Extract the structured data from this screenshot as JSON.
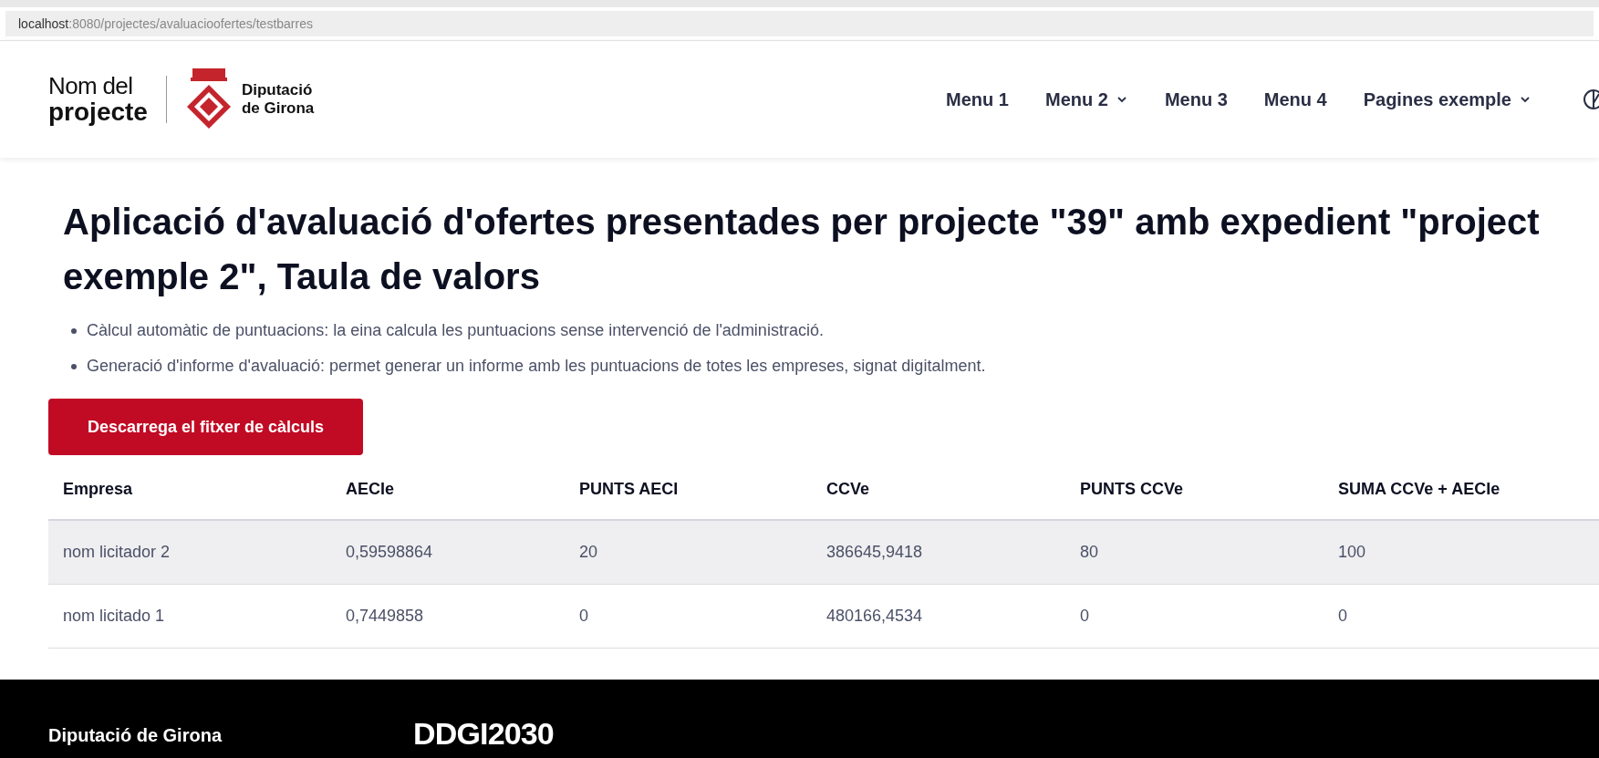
{
  "browser": {
    "url_host": "localhost",
    "url_path": ":8080/projectes/avaluacioofertes/testbarres"
  },
  "header": {
    "project_name": "Nom del",
    "project_word": "projecte",
    "org_line_1": "Diputació",
    "org_line_2": "de Girona",
    "menu": [
      {
        "label": "Menu 1",
        "has_dropdown": false
      },
      {
        "label": "Menu 2",
        "has_dropdown": true
      },
      {
        "label": "Menu 3",
        "has_dropdown": false
      },
      {
        "label": "Menu 4",
        "has_dropdown": false
      },
      {
        "label": "Pagines exemple",
        "has_dropdown": true
      }
    ]
  },
  "title_lines": [
    "Aplicació d'avaluació d'ofertes presentades per projecte \"39\" amb expedient \"project",
    "exemple 2\", Taula de valors"
  ],
  "bullets": [
    "Càlcul automàtic de puntuacions: la eina calcula les puntuacions sense intervenció de l'administració.",
    "Generació d'informe d'avaluació: permet generar un informe amb les puntuacions de totes les empreses, signat digitalment."
  ],
  "download_button": "Descarrega el fitxer de càlculs",
  "table": {
    "columns": [
      "Empresa",
      "AECIe",
      "PUNTS AECI",
      "CCVe",
      "PUNTS CCVe",
      "SUMA CCVe + AECIe"
    ],
    "rows": [
      {
        "cells": [
          "nom licitador 2",
          "0,59598864",
          "20",
          "386645,9418",
          "80",
          "100"
        ],
        "highlighted": true
      },
      {
        "cells": [
          "nom licitado 1",
          "0,7449858",
          "0",
          "480166,4534",
          "0",
          "0"
        ],
        "highlighted": false
      }
    ]
  },
  "footer": {
    "org": "Diputació de Girona",
    "logo_text": "DDGI2030"
  }
}
